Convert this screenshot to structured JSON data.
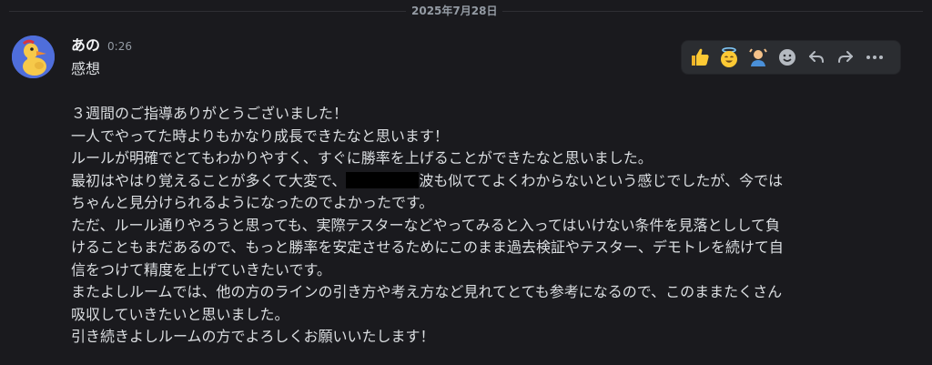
{
  "date_divider": "2025年7月28日",
  "message": {
    "author": "あの",
    "time": "0:26",
    "title": "感想",
    "lines": [
      "３週間のご指導ありがとうございました！",
      "一人でやってた時よりもかなり成長できたなと思います！",
      "ルールが明確でとてもわかりやすく、すぐに勝率を上げることができたなと思いました。",
      "最初はやはり覚えることが多くて大変で、",
      "波も似ててよくわからないという感じでしたが、今では",
      "ちゃんと見分けられるようになったのでよかったです。",
      "ただ、ルール通りやろうと思っても、実際テスターなどやってみると入ってはいけない条件を見落としして負",
      "けることもまだあるので、もっと勝率を安定させるためにこのまま過去検証やテスター、デモトレを続けて自",
      "信をつけて精度を上げていきたいです。",
      "またよしルームでは、他の方のラインの引き方や考え方など見れてとても参考になるので、このままたくさん",
      "吸収していきたいと思いました。",
      "引き続きよしルームの方でよろしくお願いいたします！"
    ]
  },
  "toolbar": {
    "actions": [
      "thumbs-up-reaction",
      "angel-smile-reaction",
      "person-reaction",
      "add-reaction",
      "reply",
      "forward",
      "more"
    ]
  },
  "colors": {
    "background": "#1a1a1e",
    "text": "#dbdee1",
    "muted": "#949ba4",
    "avatar_bg": "#4f6edb",
    "toolbar_bg": "#2b2d31"
  }
}
